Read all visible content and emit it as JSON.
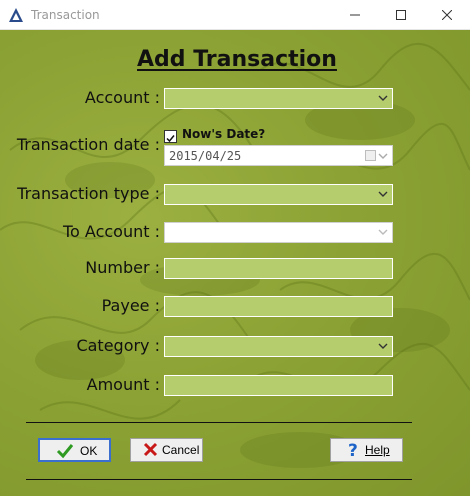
{
  "window": {
    "title": "Transaction"
  },
  "form": {
    "heading": "Add Transaction",
    "account_label": "Account :",
    "account_value": "",
    "transaction_date_label": "Transaction date :",
    "nows_date_label": "Now's Date?",
    "nows_date_checked": true,
    "transaction_date_value": "2015/04/25",
    "transaction_type_label": "Transaction type :",
    "transaction_type_value": "",
    "to_account_label": "To Account :",
    "to_account_value": "",
    "number_label": "Number :",
    "number_value": "",
    "payee_label": "Payee :",
    "payee_value": "",
    "category_label": "Category :",
    "category_value": "",
    "amount_label": "Amount :",
    "amount_value": ""
  },
  "buttons": {
    "ok": "OK",
    "cancel": "Cancel",
    "help": "Help"
  },
  "icons": {
    "app": "app-triangle-icon",
    "ok": "green-check-icon",
    "cancel": "red-x-icon",
    "help": "blue-question-icon",
    "dropdown": "chevron-down-icon",
    "calendar": "calendar-icon"
  },
  "colors": {
    "background": "#8ca234",
    "field": "#b6cd6e",
    "ok_icon": "#2e9a22",
    "cancel_icon": "#c81818",
    "help_icon": "#1e64c8"
  }
}
